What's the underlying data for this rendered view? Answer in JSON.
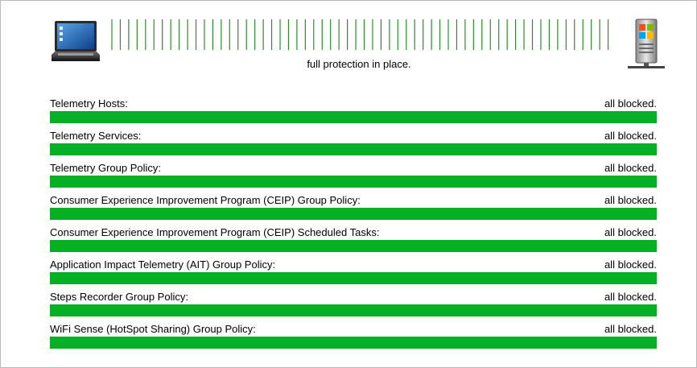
{
  "status_text": "full protection in place.",
  "icons": {
    "client": "laptop-icon",
    "server": "windows-server-icon"
  },
  "colors": {
    "progress": "#06b025",
    "link_lines": "#2e8b2e",
    "frame": "#b9b9b9"
  },
  "items": [
    {
      "label": "Telemetry Hosts:",
      "value": "all blocked.",
      "progress": 1.0
    },
    {
      "label": "Telemetry Services:",
      "value": "all blocked.",
      "progress": 1.0
    },
    {
      "label": "Telemetry Group Policy:",
      "value": "all blocked.",
      "progress": 1.0
    },
    {
      "label": "Consumer Experience Improvement Program (CEIP) Group Policy:",
      "value": "all blocked.",
      "progress": 1.0
    },
    {
      "label": "Consumer Experience Improvement Program (CEIP) Scheduled Tasks:",
      "value": "all blocked.",
      "progress": 1.0
    },
    {
      "label": "Application Impact Telemetry (AIT) Group Policy:",
      "value": "all blocked.",
      "progress": 1.0
    },
    {
      "label": "Steps Recorder Group Policy:",
      "value": "all blocked.",
      "progress": 1.0
    },
    {
      "label": "WiFi Sense (HotSpot Sharing) Group Policy:",
      "value": "all blocked.",
      "progress": 1.0
    }
  ]
}
